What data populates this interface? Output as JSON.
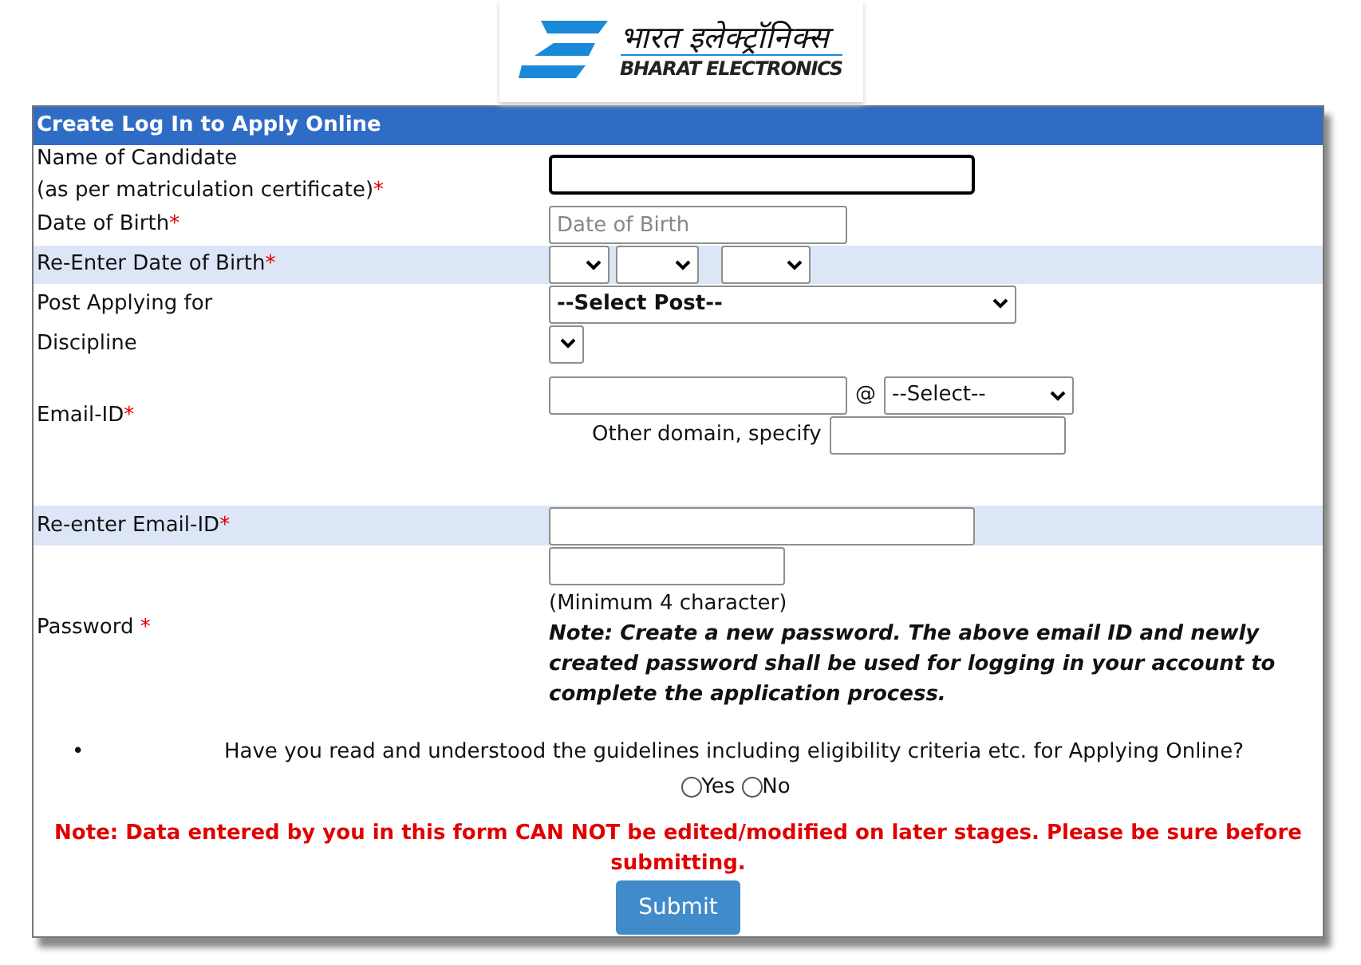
{
  "logo": {
    "hindi": "भारत इलेक्ट्रॉनिक्स",
    "english": "BHARAT ELECTRONICS"
  },
  "form": {
    "title": "Create Log In to Apply Online",
    "rows": [
      {
        "kind": "name",
        "label": "Name of Candidate",
        "sublabel": "(as per matriculation certificate)",
        "required": "*",
        "highlighted": false,
        "focused": true
      },
      {
        "kind": "date",
        "label": "Date of Birth",
        "required": "*",
        "highlighted": false,
        "placeholder": "Date of Birth"
      },
      {
        "kind": "dateselects",
        "label": "Re-Enter Date of Birth",
        "required": "*",
        "highlighted": true
      },
      {
        "kind": "post",
        "label": "Post Applying for",
        "highlighted": false,
        "value": "--Select Post--"
      },
      {
        "kind": "discipline",
        "label": "Discipline",
        "highlighted": false
      },
      {
        "kind": "email",
        "label": "Email-ID",
        "required": "*",
        "highlighted": false,
        "at": "@",
        "domain": "--Select--",
        "other_label": "Other domain, specify"
      },
      {
        "kind": "reemail",
        "label": "Re-enter Email-ID",
        "required": "*",
        "highlighted": true
      },
      {
        "kind": "password",
        "label": "Password",
        "required": "*",
        "highlighted": false,
        "hint": "(Minimum 4 character)",
        "note": "Note: Create a new password. The above email ID and newly created password shall be used for logging in your account to complete the application process."
      }
    ],
    "question": {
      "bullet": "•",
      "text": "Have you read and understood the guidelines including eligibility criteria etc. for Applying Online?",
      "options": [
        {
          "label": "Yes",
          "selected": false
        },
        {
          "label": "No",
          "selected": false
        }
      ]
    },
    "warning": "Note: Data entered by you in this form CAN NOT be edited/modified on later stages. Please be sure before submitting.",
    "submit": "Submit"
  }
}
